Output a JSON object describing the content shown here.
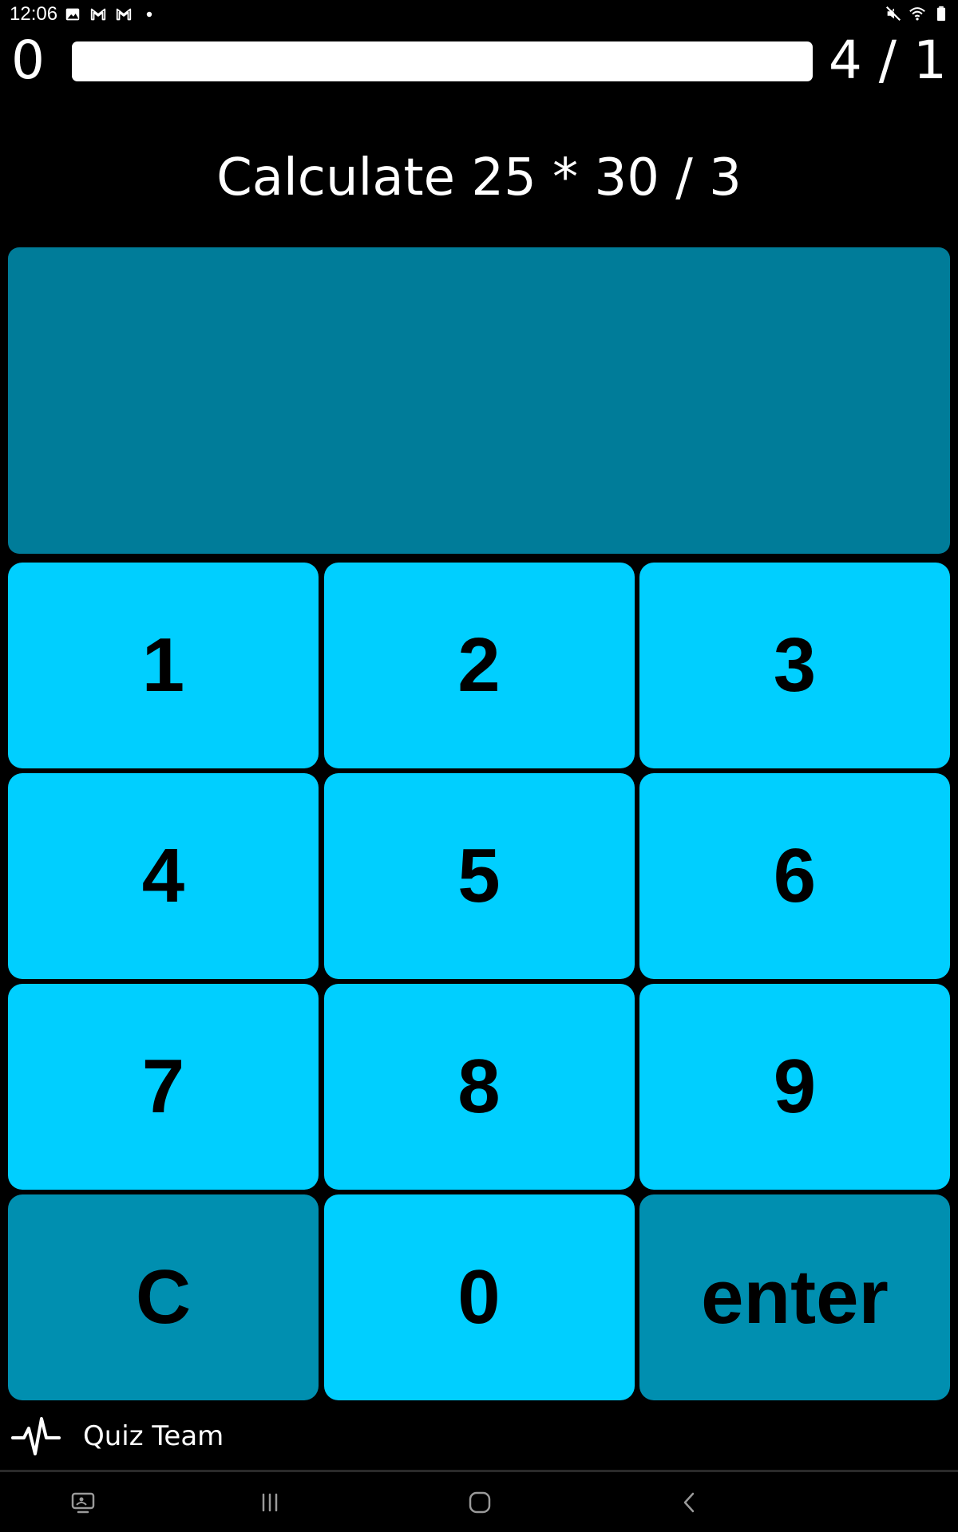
{
  "status_bar": {
    "time": "12:06",
    "left_icons": [
      "image-icon",
      "gmail-icon",
      "gmail-icon",
      "dot-icon"
    ],
    "right_icons": [
      "mute-icon",
      "wifi-icon",
      "battery-icon"
    ]
  },
  "quiz": {
    "score": "0",
    "progress_fraction": 0.0,
    "round": "4 / 1",
    "question": "Calculate 25 * 30 / 3",
    "answer": ""
  },
  "keypad": {
    "keys": [
      {
        "label": "1"
      },
      {
        "label": "2"
      },
      {
        "label": "3"
      },
      {
        "label": "4"
      },
      {
        "label": "5"
      },
      {
        "label": "6"
      },
      {
        "label": "7"
      },
      {
        "label": "8"
      },
      {
        "label": "9"
      },
      {
        "label": "C"
      },
      {
        "label": "0"
      },
      {
        "label": "enter"
      }
    ]
  },
  "footer": {
    "brand": "Quiz Team",
    "brand_icon": "pulse-icon"
  },
  "nav_bar": {
    "buttons": [
      "screenshot-icon",
      "recents-icon",
      "home-icon",
      "back-icon"
    ]
  },
  "colors": {
    "background": "#000000",
    "key": "#00cfff",
    "key_dark": "#008fb0",
    "display": "#007c99",
    "progress_track": "#ffffff"
  }
}
